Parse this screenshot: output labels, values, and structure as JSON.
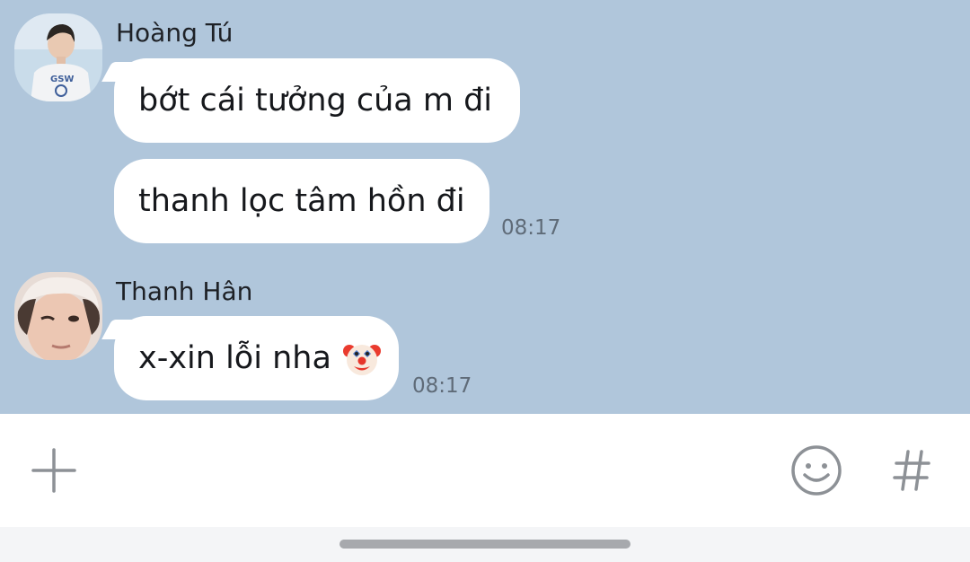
{
  "conversation": {
    "groups": [
      {
        "sender": "Hoàng Tú",
        "avatar_icon": "user-avatar-hoang-tu",
        "messages": [
          {
            "text": "bớt cái tưởng của m đi"
          },
          {
            "text": "thanh lọc tâm hồn đi",
            "time": "08:17"
          }
        ]
      },
      {
        "sender": "Thanh Hân",
        "avatar_icon": "user-avatar-thanh-han",
        "messages": [
          {
            "text": "x-xin lỗi nha",
            "emoji": "clown-face-icon",
            "time": "08:17"
          }
        ]
      }
    ]
  },
  "composer": {
    "add_icon": "plus-icon",
    "emoji_icon": "smiley-icon",
    "hashtag_icon": "hashtag-icon"
  },
  "colors": {
    "chat_background": "#b0c6db",
    "bubble": "#ffffff",
    "timestamp": "#5f6b78",
    "icon_gray": "#8d9196"
  }
}
